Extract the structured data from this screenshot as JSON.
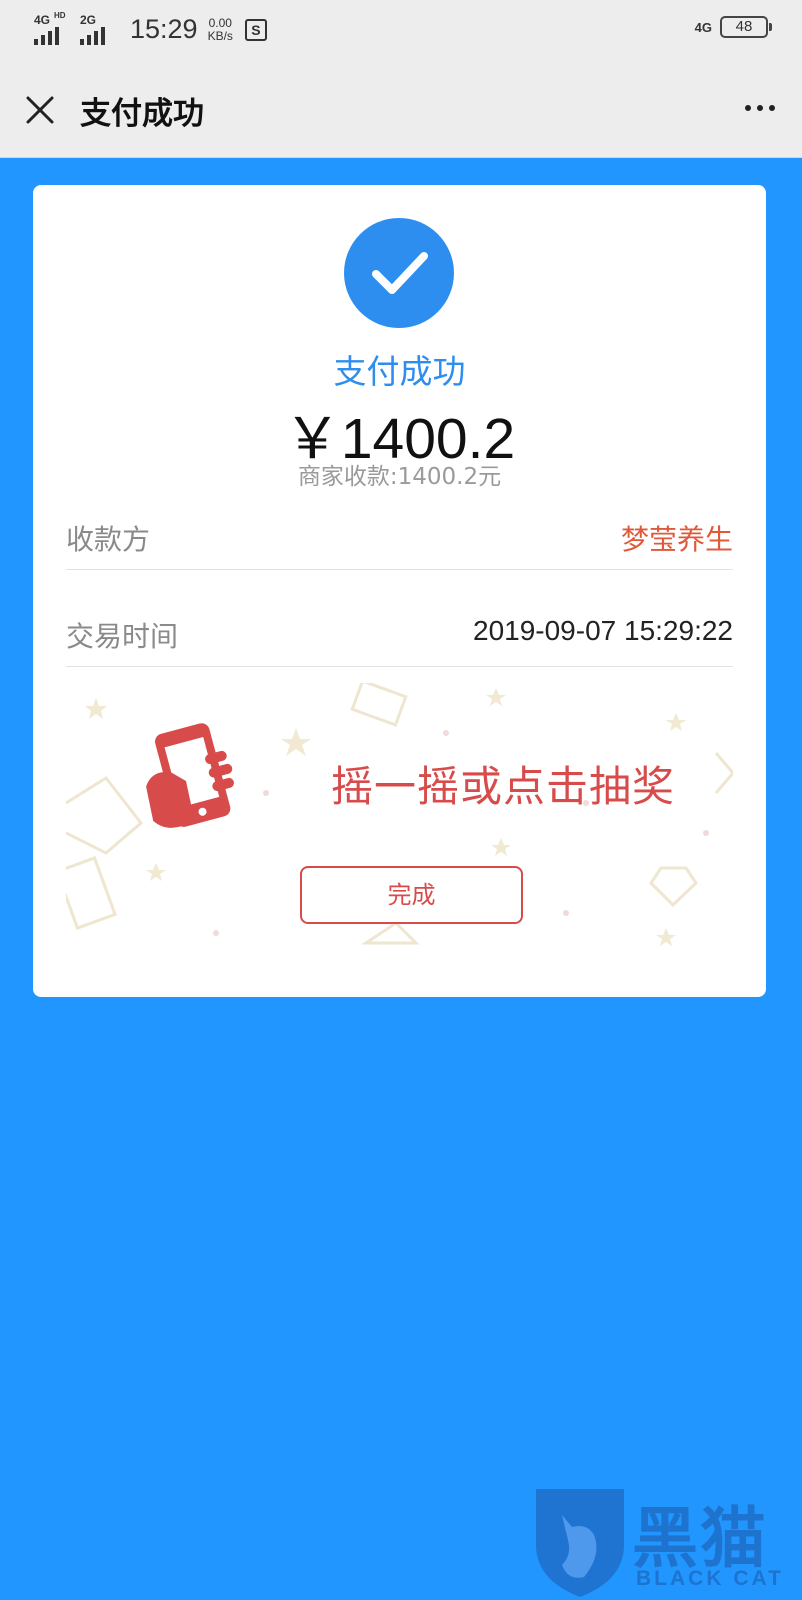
{
  "status_bar": {
    "signal1_label": "4G",
    "signal1_sup": "HD",
    "signal2_label": "2G",
    "time": "15:29",
    "speed_value": "0.00",
    "speed_unit": "KB/s",
    "app_icon": "S",
    "network_right": "4G",
    "battery": "48"
  },
  "nav": {
    "title": "支付成功",
    "close_icon": "close-icon",
    "more_icon": "more-dots-icon"
  },
  "payment": {
    "status": "支付成功",
    "amount": "￥1400.2",
    "merchant_received": "商家收款:1400.2元",
    "rows": [
      {
        "label": "收款方",
        "value": "梦莹养生",
        "value_color": "#E05A3A"
      },
      {
        "label": "交易时间",
        "value": "2019-09-07 15:29:22",
        "value_color": "#222222"
      }
    ]
  },
  "lottery": {
    "text": "摇一摇或点击抽奖",
    "button": "完成"
  },
  "watermark": {
    "cn": "黑猫",
    "en": "BLACK CAT"
  },
  "colors": {
    "background": "#2196FF",
    "accent": "#2E8EF0",
    "lottery_red": "#D84B4B"
  }
}
